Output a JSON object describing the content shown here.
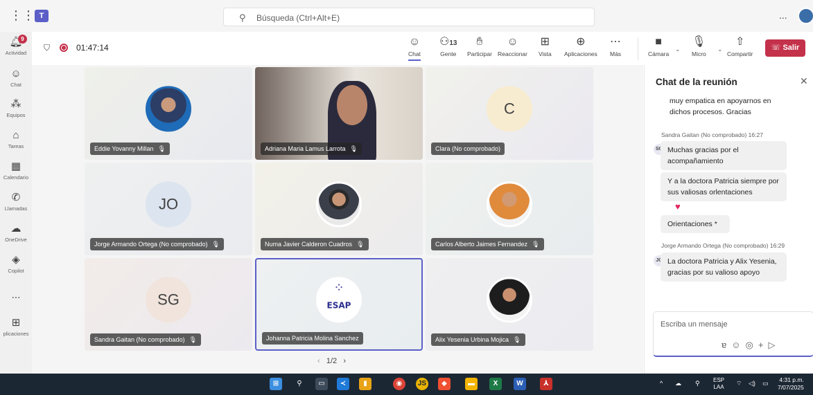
{
  "topbar": {
    "search_placeholder": "Búsqueda (Ctrl+Alt+E)",
    "apps_icon": "grid-icon",
    "more": "..."
  },
  "rail": {
    "items": [
      {
        "label": "Actividad",
        "icon": "bell-icon",
        "badge": "9"
      },
      {
        "label": "Chat",
        "icon": "chat-icon"
      },
      {
        "label": "Equipos",
        "icon": "teams-icon"
      },
      {
        "label": "Tareas",
        "icon": "tasks-icon"
      },
      {
        "label": "Calendario",
        "icon": "calendar-icon"
      },
      {
        "label": "Llamadas",
        "icon": "phone-icon"
      },
      {
        "label": "OneDrive",
        "icon": "cloud-icon"
      },
      {
        "label": "Copilot",
        "icon": "copilot-icon"
      },
      {
        "label": "...",
        "icon": "more-icon"
      },
      {
        "label": "plicaciones",
        "icon": "add-icon"
      }
    ]
  },
  "meeting": {
    "timer": "01:47:14",
    "toolbar": {
      "chat": "Chat",
      "people": "Gente",
      "people_count": "13",
      "raise": "Participar",
      "react": "Reaccionar",
      "view": "Vista",
      "apps": "Aplicaciones",
      "more": "Más",
      "camera": "Cámara",
      "mic": "Micro",
      "share": "Compartir",
      "leave": "Salir"
    },
    "pager": "1/2"
  },
  "tiles": [
    {
      "name": "Eddie Yovanny Millan",
      "muted": true
    },
    {
      "name": "Adriana Maria Lamus Larrota",
      "muted": true
    },
    {
      "name": "Clara (No comprobado)",
      "muted": false,
      "initials": "C"
    },
    {
      "name": "Jorge Armando Ortega (No comprobado)",
      "muted": true,
      "initials": "JO"
    },
    {
      "name": "Numa Javier Calderon Cuadros",
      "muted": true
    },
    {
      "name": "Carlos Alberto Jaimes Fernandez",
      "muted": true
    },
    {
      "name": "Sandra Gaitan (No comprobado)",
      "muted": true,
      "initials": "SG"
    },
    {
      "name": "Johanna Patricia Molina Sanchez",
      "muted": false,
      "logo": "ESAP"
    },
    {
      "name": "Alix Yesenia Urbina Mojica",
      "muted": true
    }
  ],
  "chat": {
    "title": "Chat de la reunión",
    "m0": "muy empatica en apoyarnos en dichos procesos. Gracias",
    "m1_meta": "Sandra Gaitan (No comprobado)  16:27",
    "m1_initials": "SG",
    "m1a": "Muchas gracias por el acompañamiento",
    "m1b": "Y a la doctora Patricia siempre por sus valiosas orlentaciones",
    "m1_reaction": "♥",
    "m1c": "Orientaciones *",
    "m2_meta": "Jorge Armando Ortega (No comprobado)  16:29",
    "m2_initials": "JO",
    "m2": "La doctora Patricia y Alix Yesenia, gracias por su valioso apoyo",
    "compose_placeholder": "Escriba un mensaje"
  },
  "taskbar": {
    "lang": "ESP",
    "lang2": "LAA",
    "time": "4:31 p.m.",
    "date": "7/07/2025"
  },
  "colors": {
    "accent": "#5b5fc7",
    "leave": "#c4314b",
    "taskbar": "#1c2734"
  }
}
